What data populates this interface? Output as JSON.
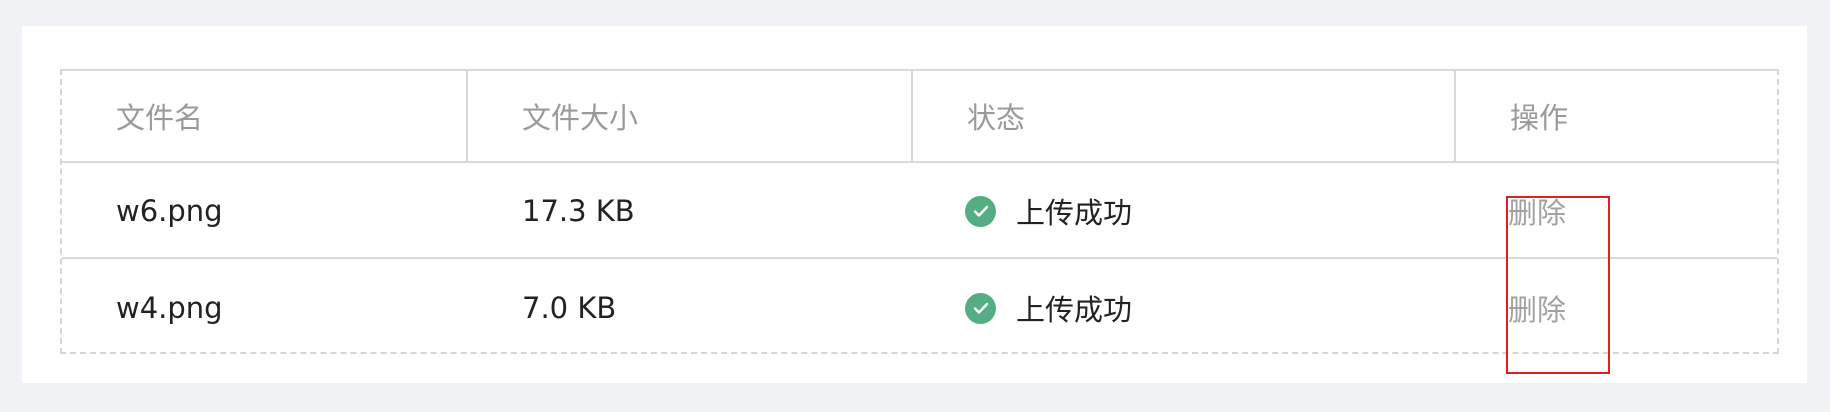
{
  "table": {
    "columns": [
      "文件名",
      "文件大小",
      "状态",
      "操作"
    ],
    "rows": [
      {
        "name": "w6.png",
        "size": "17.3 KB",
        "status": "上传成功",
        "action": "删除"
      },
      {
        "name": "w4.png",
        "size": "7.0 KB",
        "status": "上传成功",
        "action": "删除"
      }
    ]
  },
  "colors": {
    "success": "#55ad84",
    "highlight": "#e02020"
  },
  "icons": {
    "status": "check-circle-icon"
  }
}
